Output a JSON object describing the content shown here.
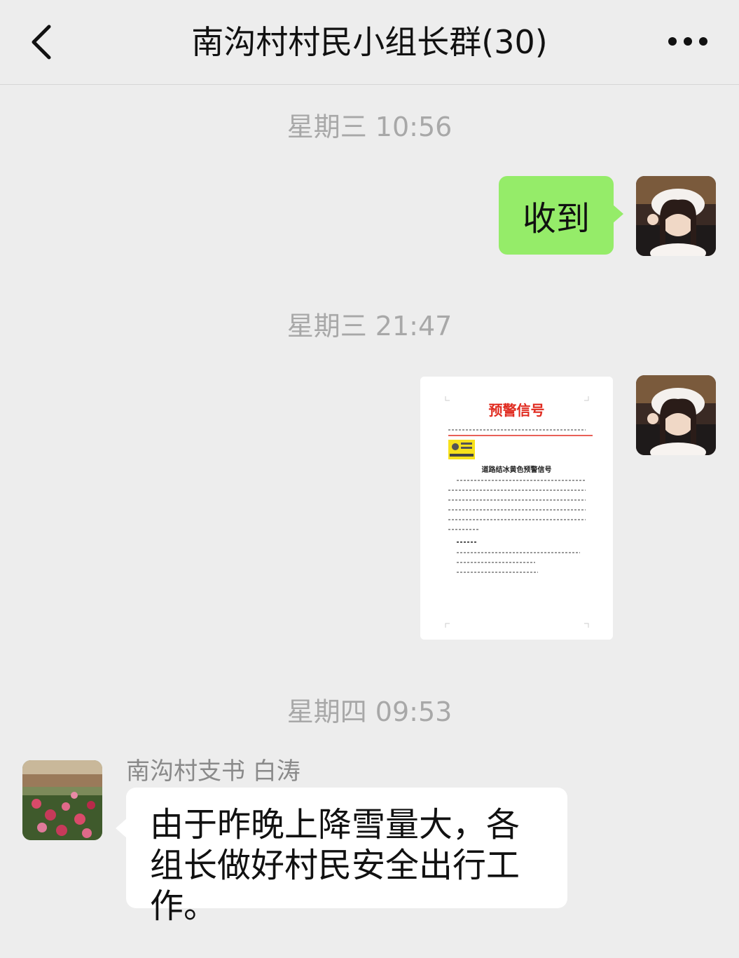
{
  "header": {
    "title": "南沟村村民小组长群(30)",
    "back_icon": "chevron-left-icon",
    "more_icon": "more-dots-icon"
  },
  "timestamps": {
    "t1": "星期三 10:56",
    "t2": "星期三 21:47",
    "t3": "星期四 09:53"
  },
  "messages": {
    "reply_text": "收到",
    "sender_name": "南沟村支书 白涛",
    "sender_text": "由于昨晚上降雪量大，各组长做好村民安全出行工作。"
  },
  "document": {
    "heading": "预警信号",
    "sub_heading": "道路结冰黄色预警信号"
  },
  "colors": {
    "background": "#ededed",
    "outgoing_bubble": "#95ec69",
    "incoming_bubble": "#ffffff",
    "timestamp_text": "#a8a8a8",
    "warning_red": "#e02b20",
    "warning_yellow": "#f7e11b"
  }
}
